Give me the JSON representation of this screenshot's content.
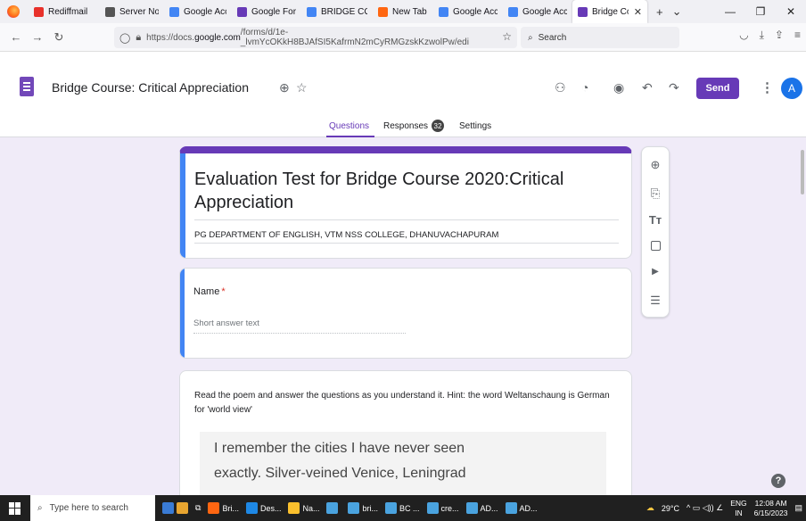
{
  "browser": {
    "tabs": [
      {
        "title": "Rediffmail",
        "icon": "rediff-icon",
        "color": "#e8312b"
      },
      {
        "title": "Server Not Fo",
        "icon": "info-icon",
        "color": "#555555"
      },
      {
        "title": "Google Accou",
        "icon": "google-icon",
        "color": "#4285f4"
      },
      {
        "title": "Google Forms",
        "icon": "forms-icon",
        "color": "#673ab7"
      },
      {
        "title": "BRIDGE COUR",
        "icon": "forms-icon",
        "color": "#4285f4"
      },
      {
        "title": "New Tab",
        "icon": "firefox-icon",
        "color": "#ff6611"
      },
      {
        "title": "Google Accou",
        "icon": "google-icon",
        "color": "#4285f4"
      },
      {
        "title": "Google Accou",
        "icon": "google-icon",
        "color": "#4285f4"
      },
      {
        "title": "Bridge Cou",
        "icon": "forms-icon",
        "color": "#673ab7",
        "active": true
      }
    ],
    "url_prefix": "https://docs.",
    "url_domain": "google.com",
    "url_rest": "/forms/d/1e-_lvmYcOKkH8BJAfSI5KafrmN2mCyRMGzskKzwolPw/edi",
    "search_placeholder": "Search"
  },
  "header": {
    "form_title": "Bridge Course: Critical Appreciation",
    "send_label": "Send",
    "avatar_letter": "A"
  },
  "form_tabs": {
    "questions": "Questions",
    "responses": "Responses",
    "responses_count": "32",
    "settings": "Settings"
  },
  "title_card": {
    "title": "Evaluation Test for Bridge Course 2020:Critical Appreciation",
    "description": "PG DEPARTMENT OF ENGLISH, VTM NSS COLLEGE, DHANUVACHAPURAM"
  },
  "name_question": {
    "label": "Name",
    "required_mark": "*",
    "placeholder": "Short answer text"
  },
  "poem_question": {
    "instruction": "Read the poem and answer the questions as you understand it. Hint: the word Weltanschaung is German for 'world view'",
    "lines": [
      "I remember the cities I have never seen",
      "exactly. Silver-veined Venice, Leningrad",
      ""
    ]
  },
  "taskbar": {
    "search_placeholder": "Type here to search",
    "apps": [
      {
        "label": "Bri...",
        "color": "#ff6611"
      },
      {
        "label": "Des...",
        "color": "#1e88e5"
      },
      {
        "label": "Na...",
        "color": "#fbc02d"
      },
      {
        "label": "",
        "color": "#4aa3df"
      },
      {
        "label": "bri...",
        "color": "#4aa3df"
      },
      {
        "label": "BC ...",
        "color": "#4aa3df"
      },
      {
        "label": "cre...",
        "color": "#4aa3df"
      },
      {
        "label": "AD...",
        "color": "#4aa3df"
      },
      {
        "label": "AD...",
        "color": "#4aa3df"
      }
    ],
    "temperature": "29°C",
    "language": "ENG",
    "region": "IN",
    "time": "12:08 AM",
    "date": "6/15/2023"
  },
  "colors": {
    "accent": "#673ab7",
    "active_question": "#4285f4"
  }
}
